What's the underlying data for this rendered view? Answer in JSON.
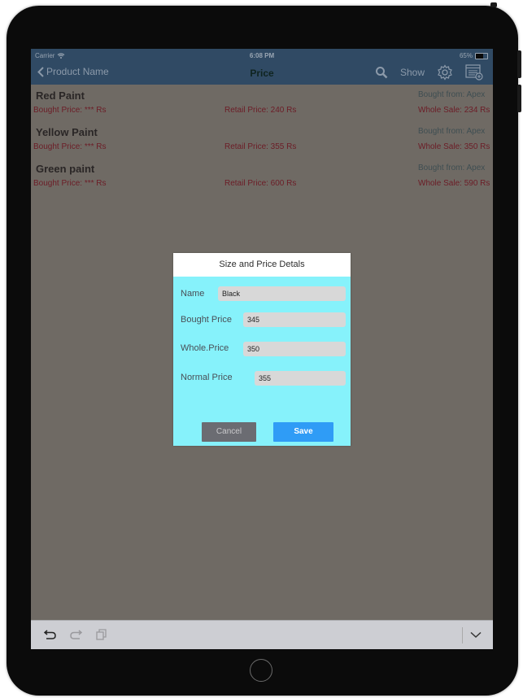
{
  "status_bar": {
    "carrier": "Carrier",
    "time": "6:08 PM",
    "battery": "65%"
  },
  "nav": {
    "back_label": "Product Name",
    "title": "Price",
    "show_label": "Show"
  },
  "products": [
    {
      "name": "Red Paint",
      "bought_from": "Bought from: Apex",
      "bought_price": "Bought Price: *** Rs",
      "retail_price": "Retail Price: 240 Rs",
      "whole_sale": "Whole Sale: 234 Rs"
    },
    {
      "name": "Yellow Paint",
      "bought_from": "Bought from: Apex",
      "bought_price": "Bought Price: *** Rs",
      "retail_price": "Retail Price: 355 Rs",
      "whole_sale": "Whole Sale: 350 Rs"
    },
    {
      "name": "Green paint",
      "bought_from": "Bought from: Apex",
      "bought_price": "Bought Price: *** Rs",
      "retail_price": "Retail Price: 600 Rs",
      "whole_sale": "Whole Sale: 590 Rs"
    }
  ],
  "dialog": {
    "title": "Size and Price Detals",
    "fields": [
      {
        "label": "Name",
        "value": "Black"
      },
      {
        "label": "Bought Price",
        "value": "345"
      },
      {
        "label": "Whole.Price",
        "value": "350"
      },
      {
        "label": "Normal Price",
        "value": "355"
      }
    ],
    "cancel_label": "Cancel",
    "save_label": "Save"
  },
  "icons": {
    "search": "search-icon",
    "settings": "gear-icon",
    "add_list": "add-list-icon",
    "undo": "undo-icon",
    "redo": "redo-icon",
    "paste": "paste-icon",
    "collapse": "chevron-down-icon"
  }
}
